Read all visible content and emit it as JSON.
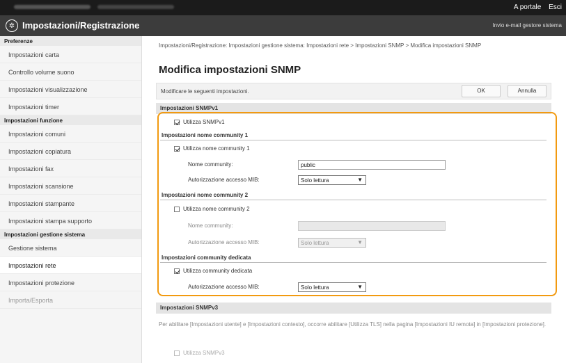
{
  "topbar": {
    "portal_link": "A portale",
    "logout_link": "Esci"
  },
  "header": {
    "title": "Impostazioni/Registrazione",
    "mail_link": "Invio e-mail gestore sistema"
  },
  "sidebar": {
    "sections": [
      {
        "title": "Preferenze",
        "items": [
          "Impostazioni carta",
          "Controllo volume suono",
          "Impostazioni visualizzazione",
          "Impostazioni timer"
        ]
      },
      {
        "title": "Impostazioni funzione",
        "items": [
          "Impostazioni comuni",
          "Impostazioni copiatura",
          "Impostazioni fax",
          "Impostazioni scansione",
          "Impostazioni stampante",
          "Impostazioni stampa supporto"
        ]
      },
      {
        "title": "Impostazioni gestione sistema",
        "items": [
          "Gestione sistema",
          "Impostazioni rete",
          "Impostazioni protezione",
          "Importa/Esporta"
        ]
      }
    ]
  },
  "main": {
    "breadcrumb": "Impostazioni/Registrazione: Impostazioni gestione sistema: Impostazioni rete > Impostazioni SNMP > Modifica impostazioni SNMP",
    "page_title": "Modifica impostazioni SNMP",
    "instruction": "Modificare le seguenti impostazioni.",
    "ok_label": "OK",
    "cancel_label": "Annulla",
    "snmpv1": {
      "header": "Impostazioni SNMPv1",
      "use_label": "Utilizza SNMPv1",
      "use_checked": true,
      "community1": {
        "header": "Impostazioni nome community 1",
        "use_label": "Utilizza nome community 1",
        "use_checked": true,
        "name_label": "Nome community:",
        "name_value": "public",
        "access_label": "Autorizzazione accesso MIB:",
        "access_value": "Solo lettura"
      },
      "community2": {
        "header": "Impostazioni nome community 2",
        "use_label": "Utilizza nome community 2",
        "use_checked": false,
        "name_label": "Nome community:",
        "name_value": "",
        "access_label": "Autorizzazione accesso MIB:",
        "access_value": "Solo lettura"
      },
      "dedicated": {
        "header": "Impostazioni community dedicata",
        "use_label": "Utilizza community dedicata",
        "use_checked": true,
        "access_label": "Autorizzazione accesso MIB:",
        "access_value": "Solo lettura"
      }
    },
    "snmpv3": {
      "header": "Impostazioni SNMPv3",
      "note": "Per abilitare [Impostazioni utente] e [Impostazioni contesto], occorre abilitare [Utilizza TLS] nella pagina [Impostazioni IU remota] in [Impostazioni protezione].",
      "use_label": "Utilizza SNMPv3",
      "use_checked": false
    }
  },
  "colors": {
    "highlight": "#f29a10",
    "topbar": "#1b1b1b",
    "titlebar": "#3c3c3c"
  }
}
